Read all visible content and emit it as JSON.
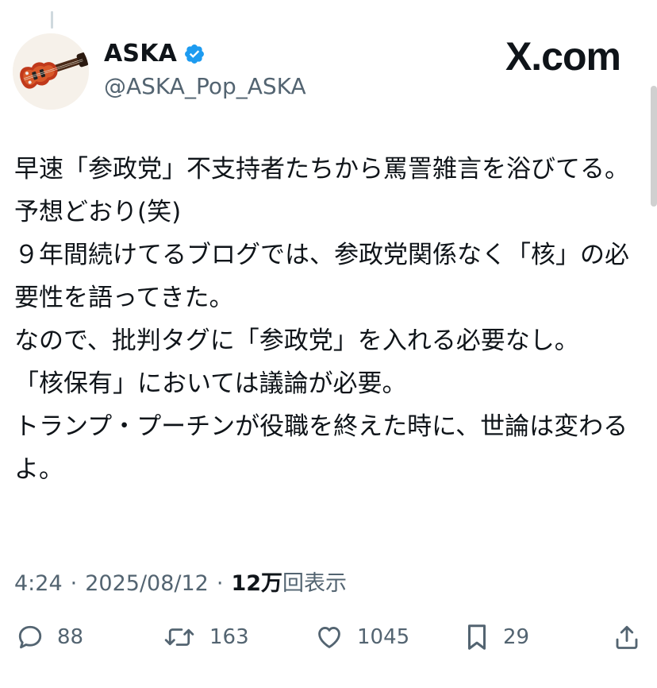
{
  "author": {
    "display_name": "ASKA",
    "handle": "@ASKA_Pop_ASKA",
    "verified_icon": "verified-badge-icon",
    "avatar_icon": "violin-bass-guitar-avatar"
  },
  "brand": {
    "logo_text": "X.com"
  },
  "tweet": {
    "lines": [
      "早速「参政党」不支持者たちから罵詈雑言を浴びてる。",
      "予想どおり(笑)",
      "９年間続けてるブログでは、参政党関係なく「核」の必要性を語ってきた。",
      "なので、批判タグに「参政党」を入れる必要なし。",
      "「核保有」においては議論が必要。",
      "トランプ・プーチンが役職を終えた時に、世論は変わるよ。"
    ]
  },
  "meta": {
    "time": "4:24",
    "separator": "·",
    "date": "2025/08/12",
    "views_count": "12万",
    "views_label": "回表示"
  },
  "actions": {
    "reply_count": "88",
    "retweet_count": "163",
    "like_count": "1045",
    "bookmark_count": "29"
  },
  "colors": {
    "text": "#0f1419",
    "secondary": "#536471",
    "verified": "#1d9bf0",
    "avatar_guitar": "#c0391b"
  }
}
